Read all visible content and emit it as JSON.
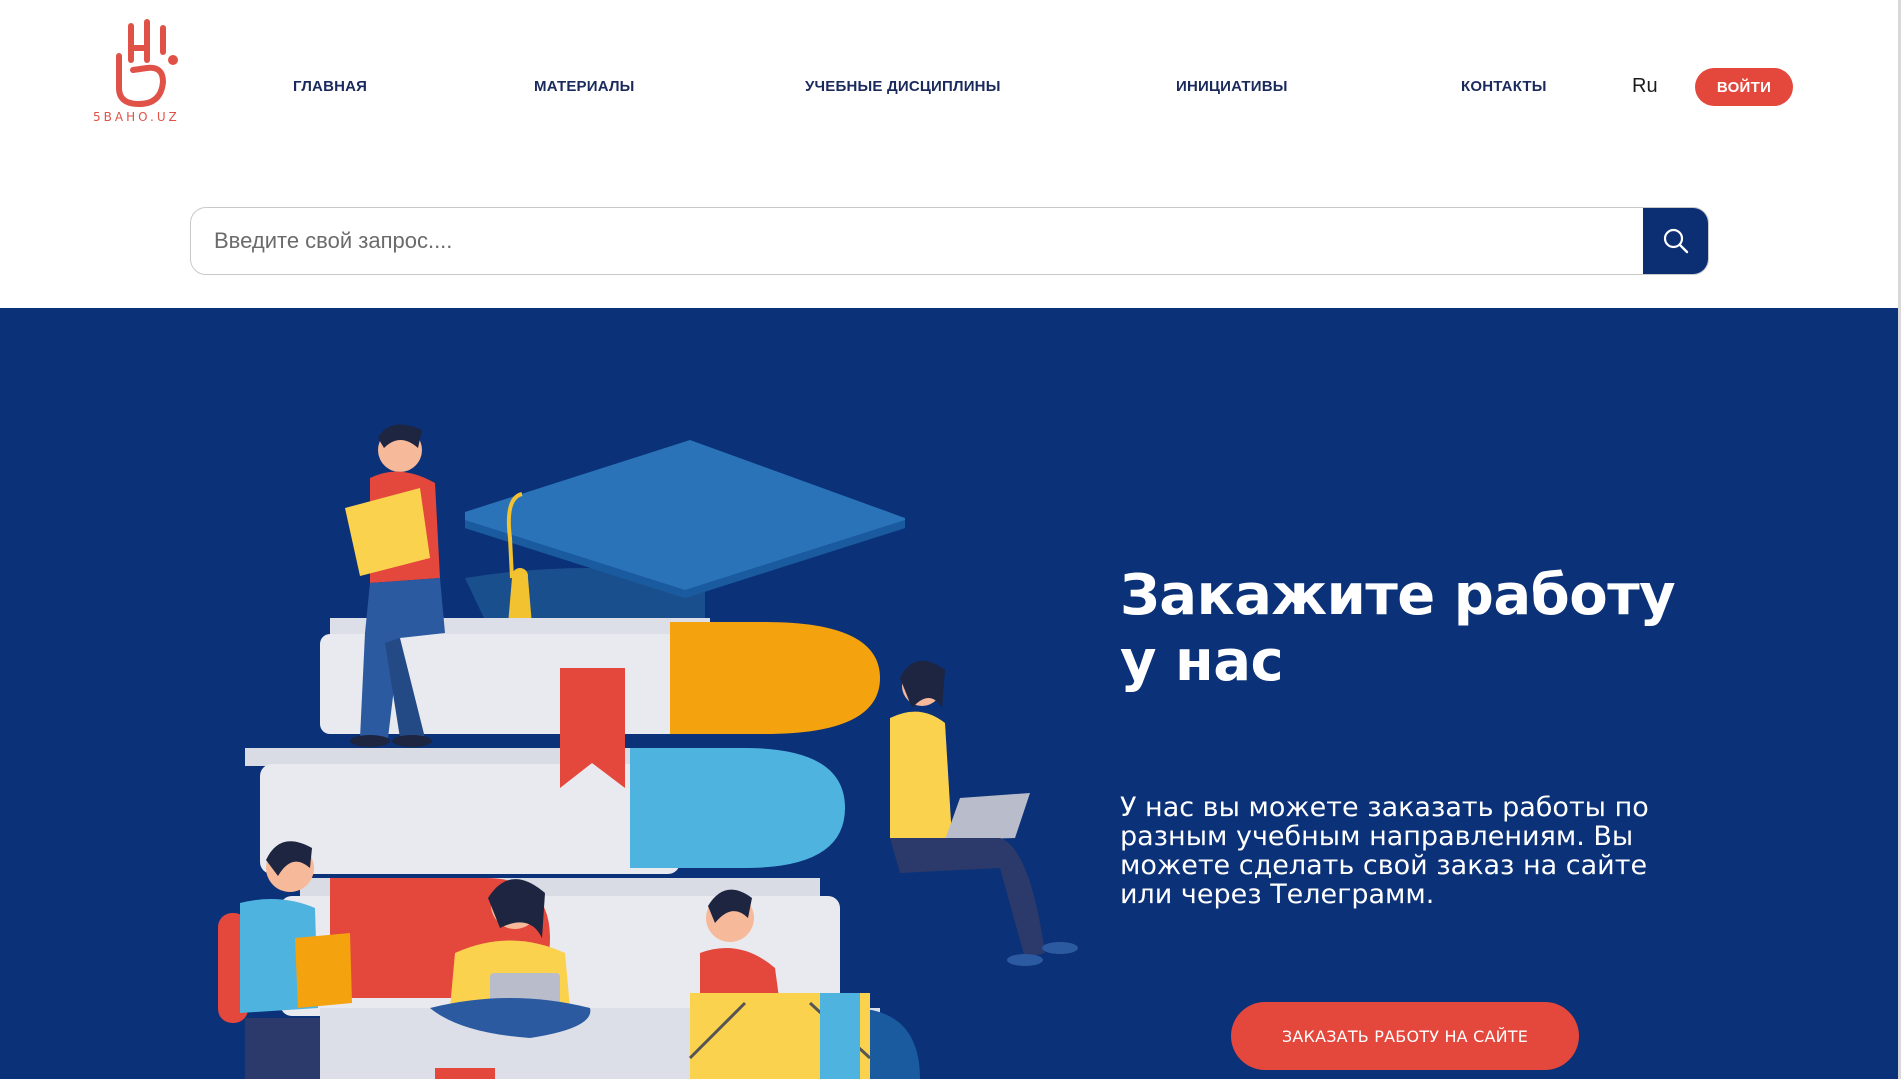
{
  "brand": {
    "logo_text": "5BAHO.UZ",
    "accent_color": "#e4473c",
    "primary_color": "#0b3178"
  },
  "nav": {
    "items": [
      {
        "label": "ГЛАВНАЯ"
      },
      {
        "label": "МАТЕРИАЛЫ"
      },
      {
        "label": "УЧЕБНЫЕ ДИСЦИПЛИНЫ"
      },
      {
        "label": "ИНИЦИАТИВЫ"
      },
      {
        "label": "КОНТАКТЫ"
      }
    ],
    "language": "Ru",
    "login_label": "ВОЙТИ"
  },
  "search": {
    "placeholder": "Введите свой запрос....",
    "value": "",
    "button_icon": "search-icon"
  },
  "hero": {
    "title": "Закажите работу у нас",
    "text": "У нас вы можете заказать работы по разным учебным направлениям. Вы можете сделать свой заказ на сайте или через Телеграмм.",
    "button_label": "ЗАКАЗАТЬ РАБОТУ НА САЙТЕ"
  }
}
